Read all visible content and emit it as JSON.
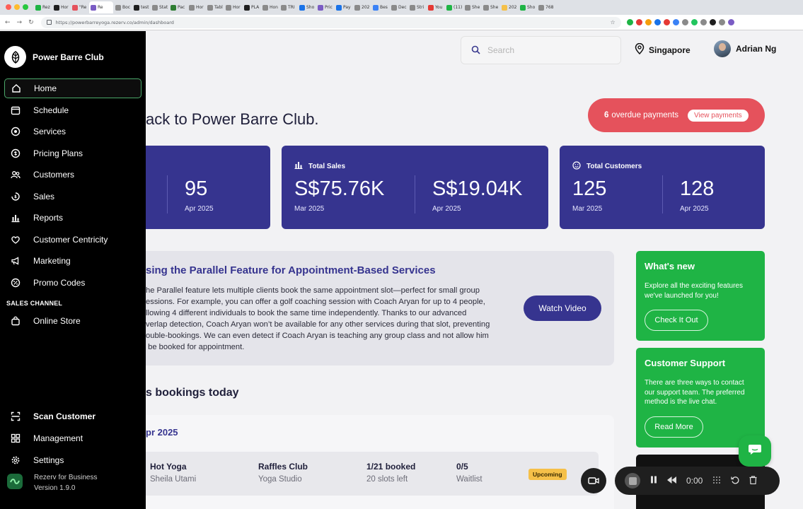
{
  "browser": {
    "url": "https://powerbarreyoga.rezerv.co/admin/dashboard",
    "tabs": [
      {
        "label": "Rez",
        "color": "#1fb445"
      },
      {
        "label": "Hor",
        "color": "#1f1f1f"
      },
      {
        "label": "\"Re",
        "color": "#e5525c"
      },
      {
        "label": "Re",
        "color": "#7a5cc4",
        "active": true
      },
      {
        "label": "Boc",
        "color": "#8a8a8a"
      },
      {
        "label": "test",
        "color": "#1f1f1f"
      },
      {
        "label": "Stat",
        "color": "#8a8a8a"
      },
      {
        "label": "Pac",
        "color": "#2e7d32"
      },
      {
        "label": "Hor",
        "color": "#8a8a8a"
      },
      {
        "label": "Tabl",
        "color": "#8a8a8a"
      },
      {
        "label": "Hor",
        "color": "#8a8a8a"
      },
      {
        "label": "PLA",
        "color": "#1f1f1f"
      },
      {
        "label": "Hon",
        "color": "#8a8a8a"
      },
      {
        "label": "TRI",
        "color": "#8a8a8a"
      },
      {
        "label": "Sho",
        "color": "#1a73e8"
      },
      {
        "label": "Pric",
        "color": "#7a5cc4"
      },
      {
        "label": "Pay",
        "color": "#1a73e8"
      },
      {
        "label": "202",
        "color": "#8a8a8a"
      },
      {
        "label": "Bes",
        "color": "#3b82f6"
      },
      {
        "label": "Dec",
        "color": "#8a8a8a"
      },
      {
        "label": "Stri",
        "color": "#8a8a8a"
      },
      {
        "label": "You",
        "color": "#e53935"
      },
      {
        "label": "(11)",
        "color": "#1fb445"
      },
      {
        "label": "She",
        "color": "#8a8a8a"
      },
      {
        "label": "She",
        "color": "#8a8a8a"
      },
      {
        "label": "202",
        "color": "#f5c049"
      },
      {
        "label": "Sho",
        "color": "#1fb445"
      },
      {
        "label": "768",
        "color": "#8a8a8a"
      }
    ],
    "extension_colors": [
      "#1fb445",
      "#e53935",
      "#f59e0b",
      "#1a73e8",
      "#e53935",
      "#3b82f6",
      "#8a8a8a",
      "#22c55e",
      "#8a8a8a",
      "#1f1f1f",
      "#8a8a8a",
      "#7a5cc4"
    ]
  },
  "sidebar": {
    "brand_name": "Power Barre Club",
    "items": [
      {
        "label": "Home",
        "icon": "home-icon",
        "active": true
      },
      {
        "label": "Schedule",
        "icon": "calendar-icon"
      },
      {
        "label": "Services",
        "icon": "services-icon"
      },
      {
        "label": "Pricing Plans",
        "icon": "pricing-icon"
      },
      {
        "label": "Customers",
        "icon": "customers-icon"
      },
      {
        "label": "Sales",
        "icon": "sales-icon"
      },
      {
        "label": "Reports",
        "icon": "reports-icon"
      },
      {
        "label": "Customer Centricity",
        "icon": "heart-hand-icon"
      },
      {
        "label": "Marketing",
        "icon": "megaphone-icon"
      },
      {
        "label": "Promo Codes",
        "icon": "promo-icon"
      }
    ],
    "sales_channel_label": "SALES CHANNEL",
    "online_store": "Online Store",
    "scan_customer": "Scan Customer",
    "management": "Management",
    "settings": "Settings",
    "app_name": "Rezerv for Business",
    "version": "Version 1.9.0"
  },
  "header": {
    "search_placeholder": "Search",
    "location": "Singapore",
    "user_name": "Adrian Ng"
  },
  "welcome_text": "ack to Power Barre Club.",
  "overdue": {
    "count": "6",
    "text": "overdue payments",
    "button": "View payments"
  },
  "stats": [
    {
      "title": "",
      "values": [
        {
          "value": "95",
          "period": "Apr 2025"
        }
      ]
    },
    {
      "title": "Total Sales",
      "values": [
        {
          "value": "S$75.76K",
          "period": "Mar 2025"
        },
        {
          "value": "S$19.04K",
          "period": "Apr 2025"
        }
      ]
    },
    {
      "title": "Total Customers",
      "values": [
        {
          "value": "125",
          "period": "Mar 2025"
        },
        {
          "value": "128",
          "period": "Apr 2025"
        }
      ]
    }
  ],
  "feature": {
    "title": "sing the Parallel Feature for Appointment-Based Services",
    "body_lines": [
      "he Parallel feature lets multiple clients book the same appointment slot—perfect for small group",
      "essions. For example, you can offer a golf coaching session with Coach Aryan for up to 4 people,",
      "llowing 4 different individuals to book the same time independently. Thanks to our advanced",
      "verlap detection, Coach Aryan won’t be available for any other services during that slot, preventing",
      "ouble-bookings. We can even detect if Coach Aryan is teaching any group class and not allow him",
      " be booked for appointment."
    ],
    "button": "Watch Video"
  },
  "whats_new": {
    "title": "What's new",
    "text_lines": [
      "Explore all the exciting features",
      "we've launched for you!"
    ],
    "button": "Check It Out"
  },
  "support": {
    "title": "Customer Support",
    "text_lines": [
      "There are three ways to contact",
      "our support team. The preferred",
      "method is the live chat."
    ],
    "button": "Read More"
  },
  "bookings": {
    "title": "s bookings today",
    "month": "pr 2025",
    "rows": [
      {
        "class_name": "Hot Yoga",
        "instructor": "Sheila Utami",
        "location": "Raffles Club",
        "room": "Yoga Studio",
        "booked": "1/21 booked",
        "slots_left": "20 slots left",
        "waitlist_count": "0/5",
        "waitlist_label": "Waitlist",
        "status": "Upcoming"
      }
    ]
  },
  "recorder": {
    "time": "0:00"
  }
}
